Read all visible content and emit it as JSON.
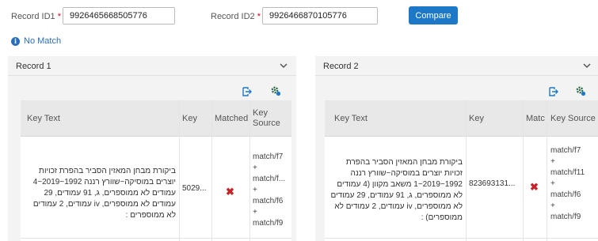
{
  "search": {
    "record_id1_label": "Record ID1",
    "record_id1_value": "9926465668505776",
    "record_id2_label": "Record ID2",
    "record_id2_value": "9926466870105776",
    "required_mark": "*",
    "compare_label": "Compare"
  },
  "status": {
    "icon": "info-icon",
    "text": "No Match"
  },
  "records": [
    {
      "title": "Record 1",
      "columns": [
        "Key Text",
        "Key",
        "Matched",
        "Key Source"
      ],
      "rows": [
        {
          "key_text": "ביקורת מבחן המאזין הסביר בהפרת זכויות יוצרים במוסיקה~שוורץ רננה 1992~2019~4 עמודים לא ממוספרים, ג, 91 עמודים, 29 עמודים לא ממוספרים, iv עמודים, 2 עמודים לא ממוספרים :",
          "key": "5029...",
          "matched": "✖",
          "key_source": [
            "match/f7",
            "+",
            "match/f...",
            "+",
            "match/f6",
            "+",
            "match/f9"
          ]
        }
      ]
    },
    {
      "title": "Record 2",
      "columns": [
        "Key Text",
        "Key",
        "Matc",
        "Key Source"
      ],
      "rows": [
        {
          "key_text": "ביקורת מבחן המאזין הסביר בהפרת זכויות יוצרים במוסיקה~שוורץ רננה 1992~2019~1 משאב מקוון (4 עמודים לא ממוספרים, ג, 91 עמודים, 29 עמודים לא ממוספרים, iv עמודים, 2 עמודים לא ממוספרים) :",
          "key": "823693131...",
          "matched": "✖",
          "key_source": [
            "match/f7",
            "+",
            "match/f11",
            "+",
            "match/f6",
            "+",
            "match/f9"
          ]
        }
      ]
    }
  ],
  "colors": {
    "accent": "#1e78c8",
    "status": "#2a6ebb",
    "no_match_x": "#c8222a",
    "panel_bg": "#f3f3f3"
  }
}
